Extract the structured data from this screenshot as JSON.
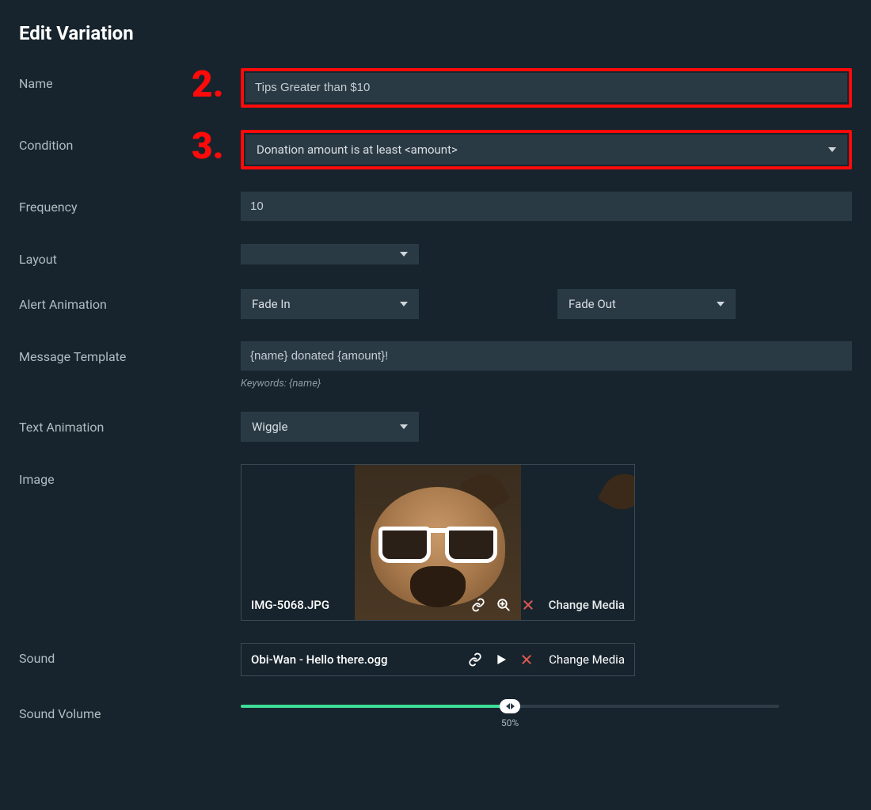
{
  "page_title": "Edit Variation",
  "callouts": {
    "name": "2.",
    "condition": "3."
  },
  "labels": {
    "name": "Name",
    "condition": "Condition",
    "frequency": "Frequency",
    "layout": "Layout",
    "alert_animation": "Alert Animation",
    "message_template": "Message Template",
    "text_animation": "Text Animation",
    "image": "Image",
    "sound": "Sound",
    "sound_volume": "Sound Volume"
  },
  "fields": {
    "name": "Tips Greater than $10",
    "condition": "Donation amount is at least <amount>",
    "frequency": "10",
    "layout": "",
    "alert_animation_in": "Fade In",
    "alert_animation_out": "Fade Out",
    "message_template": "{name} donated {amount}!",
    "message_template_hint": "Keywords: {name}",
    "text_animation": "Wiggle"
  },
  "image": {
    "filename": "IMG-5068.JPG",
    "change_label": "Change Media"
  },
  "sound": {
    "filename": "Obi-Wan - Hello there.ogg",
    "change_label": "Change Media"
  },
  "volume": {
    "percent": 50,
    "label": "50%"
  }
}
